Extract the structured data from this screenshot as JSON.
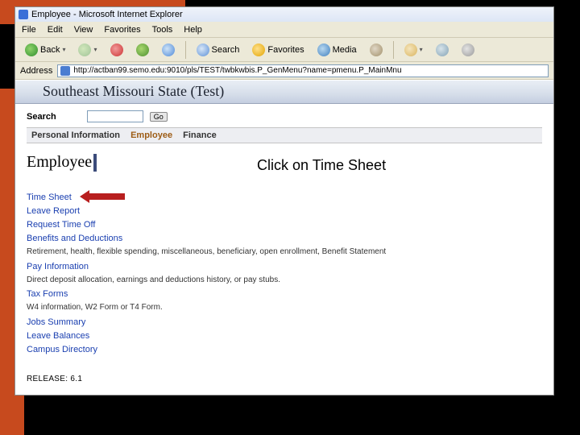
{
  "window": {
    "title": "Employee - Microsoft Internet Explorer"
  },
  "menubar": [
    "File",
    "Edit",
    "View",
    "Favorites",
    "Tools",
    "Help"
  ],
  "toolbar": {
    "back": "Back",
    "search": "Search",
    "favorites": "Favorites",
    "media": "Media"
  },
  "address": {
    "label": "Address",
    "url": "http://actban99.semo.edu:9010/pls/TEST/twbkwbis.P_GenMenu?name=pmenu.P_MainMnu"
  },
  "banner": {
    "title": "Southeast Missouri State (Test)"
  },
  "search": {
    "label": "Search",
    "go": "Go"
  },
  "tabs": [
    {
      "label": "Personal Information",
      "active": false,
      "plain": true
    },
    {
      "label": "Employee",
      "active": true
    },
    {
      "label": "Finance",
      "active": false,
      "plain": true
    }
  ],
  "page": {
    "title": "Employee"
  },
  "callout": {
    "text": "Click on Time Sheet"
  },
  "links": {
    "timesheet": "Time Sheet",
    "leave_report": "Leave Report",
    "request_time_off": "Request Time Off",
    "benefits": "Benefits and Deductions",
    "benefits_desc": "Retirement, health, flexible spending, miscellaneous, beneficiary, open enrollment, Benefit Statement",
    "pay_info": "Pay Information",
    "pay_info_desc": "Direct deposit allocation, earnings and deductions history, or pay stubs.",
    "tax_forms": "Tax Forms",
    "tax_forms_desc": "W4 information, W2 Form or T4 Form.",
    "jobs_summary": "Jobs Summary",
    "leave_balances": "Leave Balances",
    "campus_directory": "Campus Directory"
  },
  "release": {
    "label": "RELEASE: 6.1"
  }
}
